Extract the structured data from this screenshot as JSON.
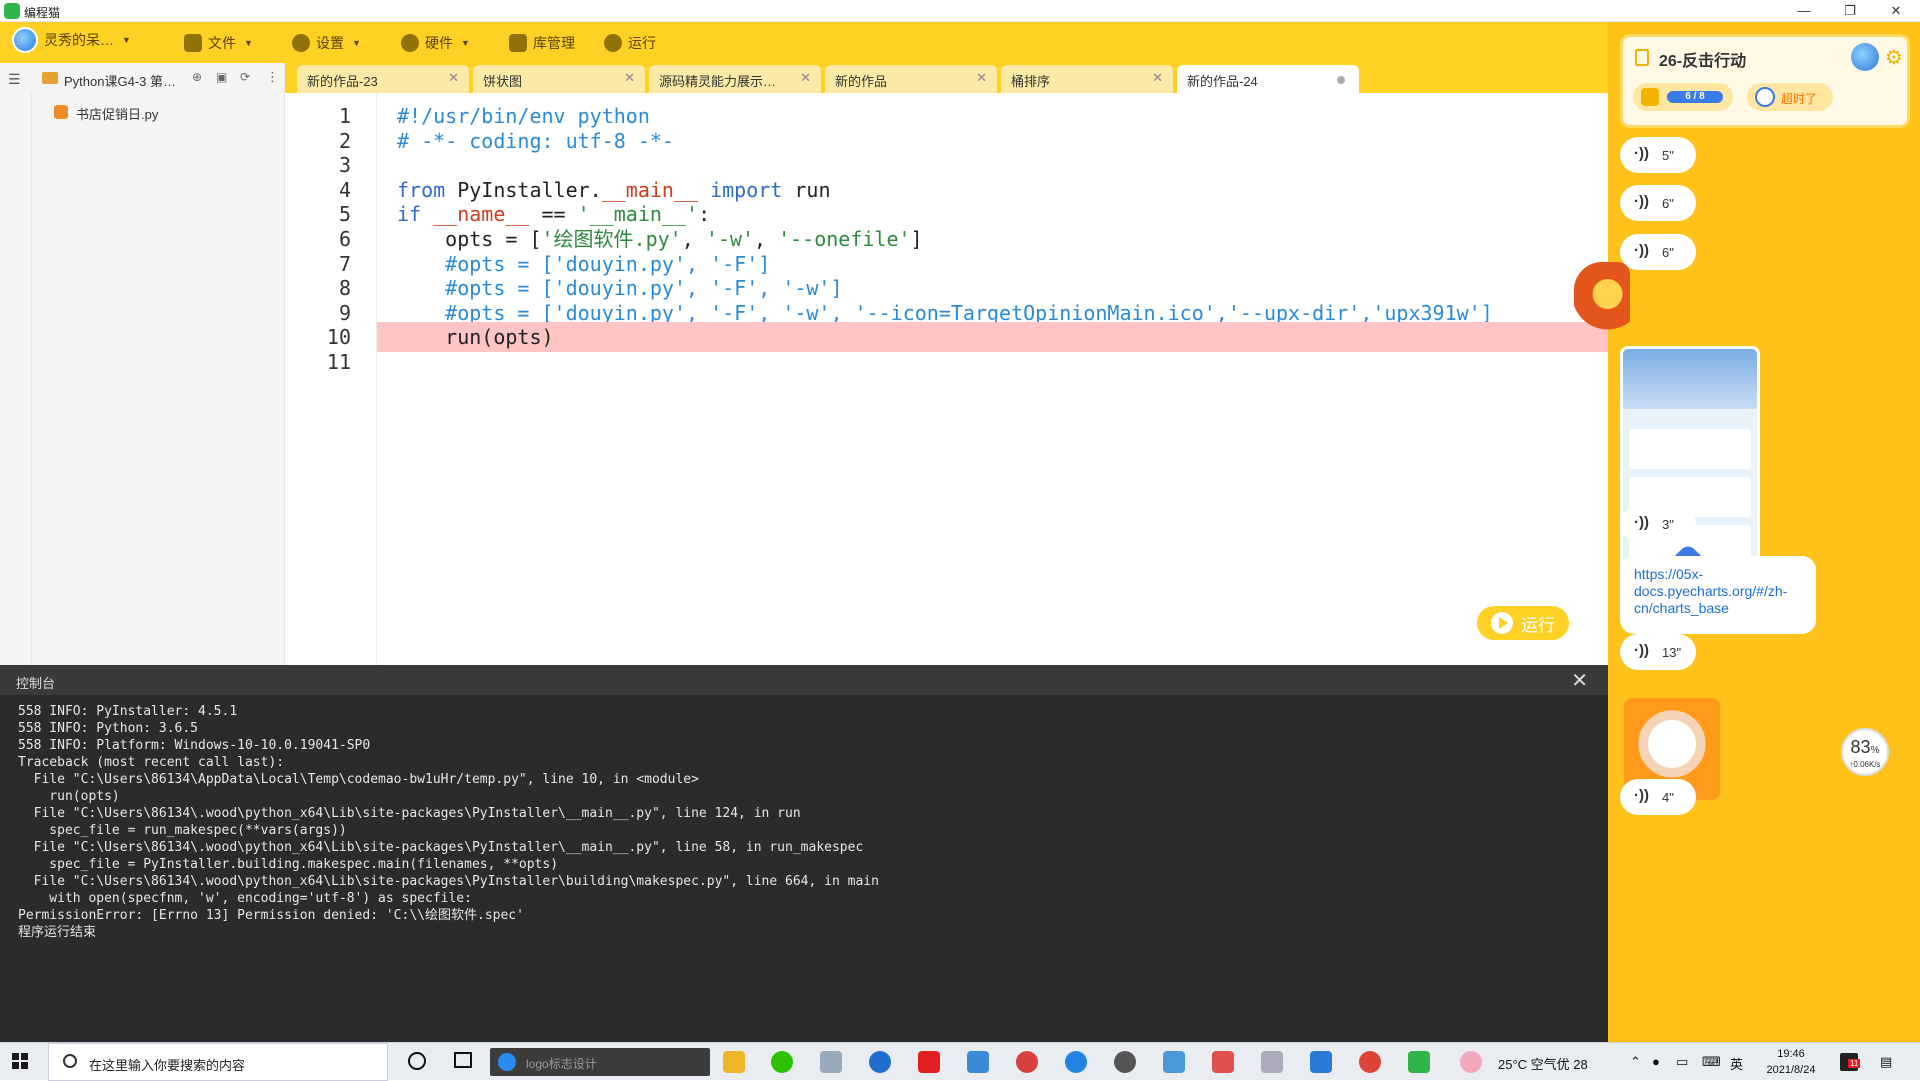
{
  "window": {
    "title": "编程猫"
  },
  "menubar": {
    "user": "灵秀的呆…",
    "items": [
      "文件",
      "设置",
      "硬件",
      "库管理",
      "运行"
    ]
  },
  "project": {
    "name": "Python课G4-3 第…"
  },
  "tabs": [
    {
      "label": "新的作品-23",
      "active": false
    },
    {
      "label": "饼状图",
      "active": false
    },
    {
      "label": "源码精灵能力展示…",
      "active": false
    },
    {
      "label": "新的作品",
      "active": false
    },
    {
      "label": "桶排序",
      "active": false
    },
    {
      "label": "新的作品-24",
      "active": true
    }
  ],
  "files": [
    {
      "name": "书店促销日.py"
    }
  ],
  "editor": {
    "highlight_line": 10,
    "lines": [
      "#!/usr/bin/env python",
      "# -*- coding: utf-8 -*-",
      "",
      "from PyInstaller.__main__ import run",
      "if __name__ == '__main__':",
      "    opts = ['绘图软件.py', '-w', '--onefile']",
      "    #opts = ['douyin.py', '-F']",
      "    #opts = ['douyin.py', '-F', '-w']",
      "    #opts = ['douyin.py', '-F', '-w', '--icon=TargetOpinionMain.ico','--upx-dir','upx391w']",
      "    run(opts)",
      ""
    ],
    "run_label": "运行"
  },
  "console": {
    "title": "控制台",
    "output": "558 INFO: PyInstaller: 4.5.1\n558 INFO: Python: 3.6.5\n558 INFO: Platform: Windows-10-10.0.19041-SP0\nTraceback (most recent call last):\n  File \"C:\\Users\\86134\\AppData\\Local\\Temp\\codemao-bw1uHr/temp.py\", line 10, in <module>\n    run(opts)\n  File \"C:\\Users\\86134\\.wood\\python_x64\\Lib\\site-packages\\PyInstaller\\__main__.py\", line 124, in run\n    spec_file = run_makespec(**vars(args))\n  File \"C:\\Users\\86134\\.wood\\python_x64\\Lib\\site-packages\\PyInstaller\\__main__.py\", line 58, in run_makespec\n    spec_file = PyInstaller.building.makespec.main(filenames, **opts)\n  File \"C:\\Users\\86134\\.wood\\python_x64\\Lib\\site-packages\\PyInstaller\\building\\makespec.py\", line 664, in main\n    with open(specfnm, 'w', encoding='utf-8') as specfile:\nPermissionError: [Errno 13] Permission denied: 'C:\\\\绘图软件.spec'\n程序运行结束"
  },
  "chat": {
    "task_title": "26-反击行动",
    "progress": "6 / 8",
    "late_label": "超时了",
    "voices": [
      "5\"",
      "6\"",
      "6\"",
      "3\"",
      "13\"",
      "4\""
    ],
    "link": "https://05x-docs.pyecharts.org/#/zh-cn/charts_base",
    "net_percent": "83",
    "net_percent_unit": "%",
    "net_speed": "↑0.06K/s"
  },
  "taskbar": {
    "search_placeholder": "在这里输入你要搜索的内容",
    "edge_placeholder": "logo标志设计",
    "weather": "25°C  空气优 28",
    "ime": "英",
    "time": "19:46",
    "date": "2021/8/24",
    "notif_count": "11"
  }
}
